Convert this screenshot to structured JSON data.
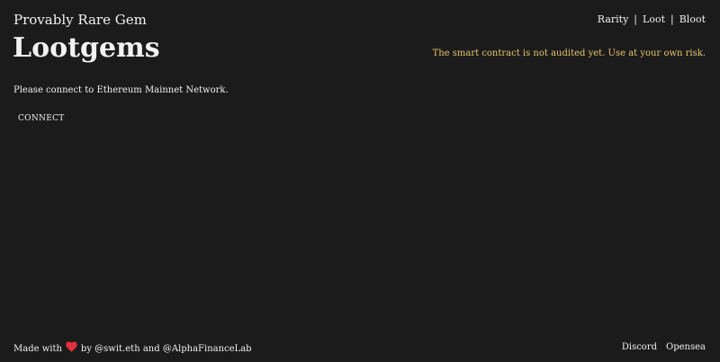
{
  "header": {
    "subtitle": "Provably Rare Gem",
    "title": "Lootgems"
  },
  "topnav": {
    "items": [
      "Rarity",
      "Loot",
      "Bloot"
    ],
    "separator": "|"
  },
  "warning": {
    "text": "The smart contract is not audited yet. Use at your own risk.",
    "color": "#e8c66a"
  },
  "main": {
    "connect_message": "Please connect to Ethereum Mainnet Network.",
    "connect_button": "CONNECT"
  },
  "footer": {
    "made_with": "Made with",
    "heart_icon": "heart-icon",
    "by_text": "by",
    "author_link": "@swit.eth",
    "and_text": "and",
    "org_link": "@AlphaFinanceLab",
    "links": [
      "Discord",
      "Opensea"
    ]
  }
}
